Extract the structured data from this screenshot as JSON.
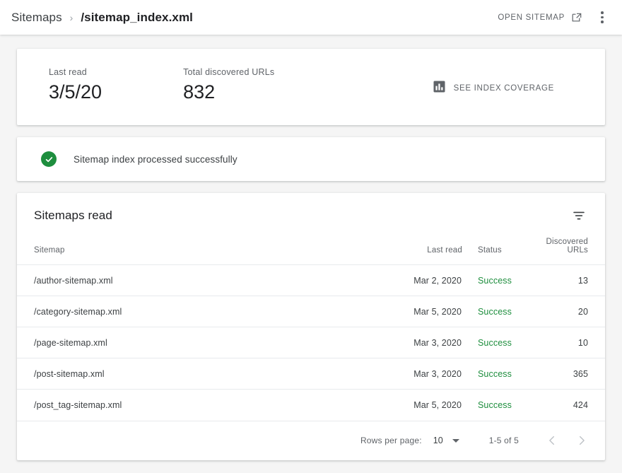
{
  "appbar": {
    "breadcrumb_root": "Sitemaps",
    "breadcrumb_separator": "›",
    "breadcrumb_current": "/sitemap_index.xml",
    "open_sitemap_label": "OPEN SITEMAP",
    "open_sitemap_icon": "external-link-icon",
    "overflow_icon": "more-vert-icon"
  },
  "summary": {
    "metrics": [
      {
        "label": "Last read",
        "value": "3/5/20"
      },
      {
        "label": "Total discovered URLs",
        "value": "832"
      }
    ],
    "coverage_label": "SEE INDEX COVERAGE",
    "coverage_icon": "bar-chart-icon"
  },
  "banner": {
    "icon": "check-circle-icon",
    "text": "Sitemap index processed successfully",
    "color": "#1e8e3e"
  },
  "table": {
    "title": "Sitemaps read",
    "filter_icon": "filter-list-icon",
    "columns": [
      "Sitemap",
      "Last read",
      "Status",
      "Discovered URLs"
    ],
    "rows": [
      {
        "sitemap": "/author-sitemap.xml",
        "last_read": "Mar 2, 2020",
        "status": "Success",
        "urls": "13"
      },
      {
        "sitemap": "/category-sitemap.xml",
        "last_read": "Mar 5, 2020",
        "status": "Success",
        "urls": "20"
      },
      {
        "sitemap": "/page-sitemap.xml",
        "last_read": "Mar 3, 2020",
        "status": "Success",
        "urls": "10"
      },
      {
        "sitemap": "/post-sitemap.xml",
        "last_read": "Mar 3, 2020",
        "status": "Success",
        "urls": "365"
      },
      {
        "sitemap": "/post_tag-sitemap.xml",
        "last_read": "Mar 5, 2020",
        "status": "Success",
        "urls": "424"
      }
    ],
    "status_color": "#1e8e3e"
  },
  "pagination": {
    "rows_per_page_label": "Rows per page:",
    "rows_per_page_value": "10",
    "dropdown_icon": "caret-down-icon",
    "range_label": "1-5 of 5",
    "prev_icon": "chevron-left-icon",
    "next_icon": "chevron-right-icon"
  }
}
